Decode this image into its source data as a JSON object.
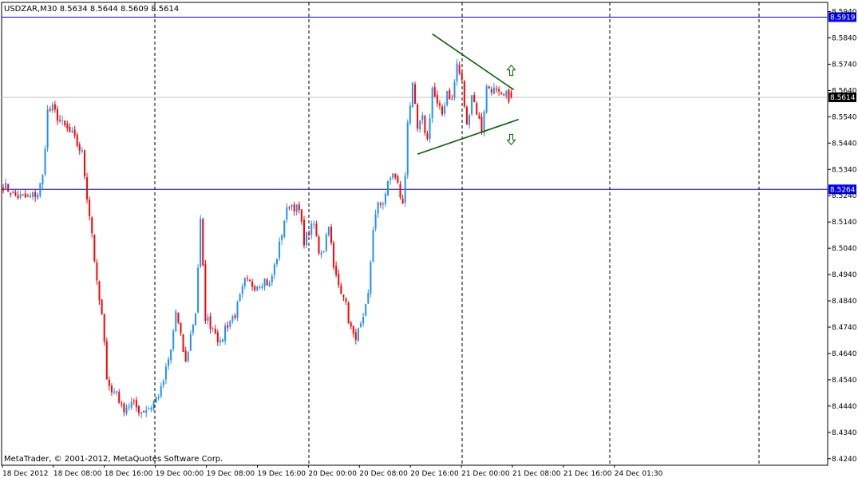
{
  "header": {
    "symbol_text": "USDZAR,M30  8.5634 8.5644 8.5609 8.5614"
  },
  "footer": {
    "copyright": "MetaTrader, © 2001-2012, MetaQuotes Software Corp."
  },
  "colors": {
    "bull": "#1e90ff",
    "bear": "#ff0000",
    "hline": "#0000ff",
    "trend": "#006400",
    "grid": "#000000",
    "price_line": "#c0c0c0"
  },
  "icons": {
    "up_arrow": "hollow-up-arrow-icon",
    "down_arrow": "hollow-down-arrow-icon"
  },
  "chart_data": {
    "type": "candlestick",
    "symbol": "USDZAR",
    "timeframe": "M30",
    "last_ohlc": {
      "open": 8.5634,
      "high": 8.5644,
      "low": 8.5609,
      "close": 8.5614
    },
    "ylim": [
      8.4215,
      8.5975
    ],
    "y_ticks": [
      "8.5940",
      "8.5840",
      "8.5740",
      "8.5640",
      "8.5540",
      "8.5440",
      "8.5340",
      "8.5240",
      "8.5140",
      "8.5040",
      "8.4940",
      "8.4840",
      "8.4740",
      "8.4640",
      "8.4540",
      "8.4440",
      "8.4340",
      "8.4240"
    ],
    "y_tick_values": [
      8.594,
      8.584,
      8.574,
      8.564,
      8.554,
      8.544,
      8.534,
      8.524,
      8.514,
      8.504,
      8.494,
      8.484,
      8.474,
      8.464,
      8.454,
      8.444,
      8.434,
      8.424
    ],
    "x_labels": [
      "18 Dec 2012",
      "18 Dec 08:00",
      "18 Dec 16:00",
      "19 Dec 00:00",
      "19 Dec 08:00",
      "19 Dec 16:00",
      "20 Dec 00:00",
      "20 Dec 08:00",
      "20 Dec 16:00",
      "21 Dec 00:00",
      "21 Dec 08:00",
      "21 Dec 16:00",
      "24 Dec 01:30"
    ],
    "grid": "vertical dashed at session breaks",
    "horizontal_lines": [
      {
        "value": 8.5919,
        "label": "8.5919"
      },
      {
        "value": 8.5264,
        "label": "8.5264"
      }
    ],
    "current_price": {
      "value": 8.5614,
      "label": "8.5614"
    },
    "trendlines": [
      {
        "from": {
          "bar": 174,
          "price": 8.5855
        },
        "to": {
          "bar": 207,
          "price": 8.5643
        }
      },
      {
        "from": {
          "bar": 168,
          "price": 8.5398
        },
        "to": {
          "bar": 209,
          "price": 8.553
        }
      }
    ],
    "arrows": [
      {
        "direction": "up",
        "bar": 206,
        "price": 8.5715
      },
      {
        "direction": "down",
        "bar": 206,
        "price": 8.5455
      }
    ],
    "keypoints": [
      [
        0,
        8.528
      ],
      [
        5,
        8.524
      ],
      [
        10,
        8.523
      ],
      [
        14,
        8.525
      ],
      [
        16,
        8.531
      ],
      [
        18,
        8.556
      ],
      [
        20,
        8.557
      ],
      [
        24,
        8.551
      ],
      [
        28,
        8.547
      ],
      [
        32,
        8.54
      ],
      [
        34,
        8.524
      ],
      [
        36,
        8.51
      ],
      [
        38,
        8.49
      ],
      [
        40,
        8.478
      ],
      [
        42,
        8.456
      ],
      [
        44,
        8.449
      ],
      [
        46,
        8.45
      ],
      [
        48,
        8.443
      ],
      [
        52,
        8.445
      ],
      [
        56,
        8.442
      ],
      [
        60,
        8.444
      ],
      [
        64,
        8.45
      ],
      [
        68,
        8.465
      ],
      [
        70,
        8.48
      ],
      [
        74,
        8.46
      ],
      [
        76,
        8.471
      ],
      [
        78,
        8.48
      ],
      [
        80,
        8.514
      ],
      [
        82,
        8.478
      ],
      [
        84,
        8.475
      ],
      [
        86,
        8.473
      ],
      [
        88,
        8.467
      ],
      [
        90,
        8.474
      ],
      [
        94,
        8.479
      ],
      [
        98,
        8.491
      ],
      [
        102,
        8.49
      ],
      [
        106,
        8.492
      ],
      [
        108,
        8.49
      ],
      [
        110,
        8.497
      ],
      [
        112,
        8.505
      ],
      [
        114,
        8.515
      ],
      [
        116,
        8.521
      ],
      [
        118,
        8.52
      ],
      [
        120,
        8.518
      ],
      [
        122,
        8.507
      ],
      [
        126,
        8.513
      ],
      [
        128,
        8.503
      ],
      [
        130,
        8.504
      ],
      [
        132,
        8.514
      ],
      [
        134,
        8.496
      ],
      [
        136,
        8.49
      ],
      [
        138,
        8.487
      ],
      [
        140,
        8.477
      ],
      [
        142,
        8.47
      ],
      [
        144,
        8.472
      ],
      [
        146,
        8.476
      ],
      [
        148,
        8.486
      ],
      [
        150,
        8.512
      ],
      [
        152,
        8.52
      ],
      [
        154,
        8.522
      ],
      [
        156,
        8.528
      ],
      [
        158,
        8.533
      ],
      [
        160,
        8.528
      ],
      [
        162,
        8.52
      ],
      [
        163,
        8.532
      ],
      [
        164,
        8.553
      ],
      [
        166,
        8.565
      ],
      [
        168,
        8.549
      ],
      [
        170,
        8.553
      ],
      [
        172,
        8.545
      ],
      [
        174,
        8.565
      ],
      [
        176,
        8.558
      ],
      [
        178,
        8.555
      ],
      [
        180,
        8.564
      ],
      [
        182,
        8.56
      ],
      [
        184,
        8.574
      ],
      [
        186,
        8.567
      ],
      [
        188,
        8.55
      ],
      [
        190,
        8.563
      ],
      [
        192,
        8.556
      ],
      [
        194,
        8.549
      ],
      [
        196,
        8.565
      ],
      [
        198,
        8.565
      ],
      [
        200,
        8.563
      ],
      [
        202,
        8.561
      ],
      [
        204,
        8.562
      ],
      [
        206,
        8.5614
      ]
    ]
  }
}
